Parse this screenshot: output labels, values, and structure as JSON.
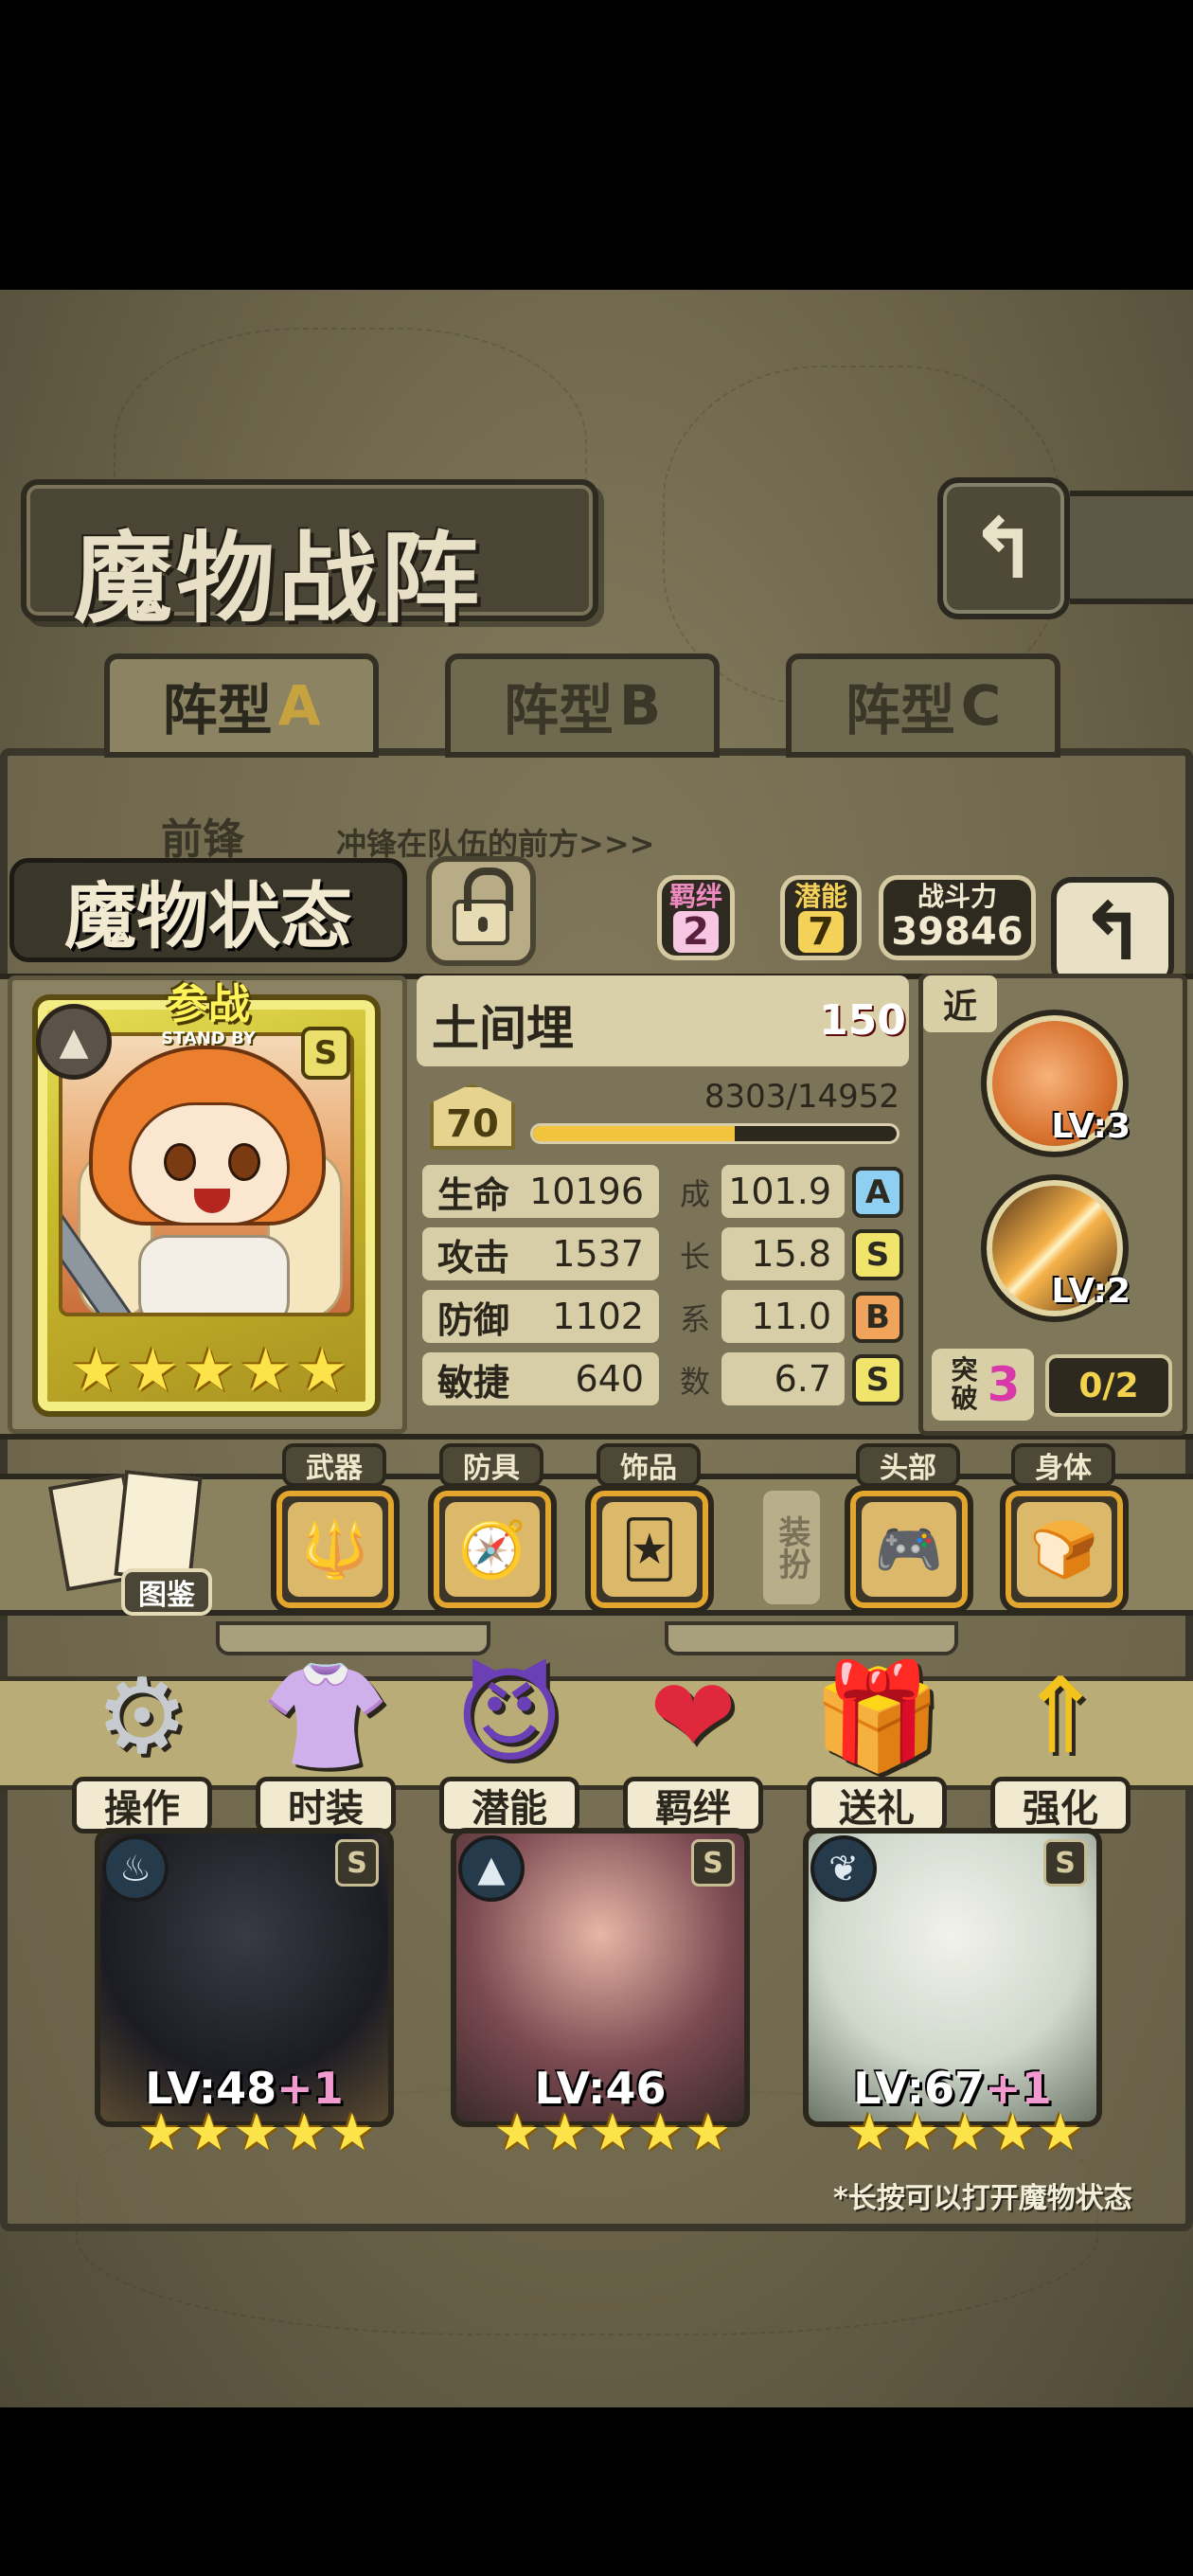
{
  "screen": {
    "title": "魔物战阵",
    "back_icon": "return-arrow-icon",
    "tabs": [
      {
        "prefix": "阵型",
        "letter": "A",
        "active": true
      },
      {
        "prefix": "阵型",
        "letter": "B",
        "active": false
      },
      {
        "prefix": "阵型",
        "letter": "C",
        "active": false
      }
    ],
    "vanguard": {
      "label": "前锋",
      "subtitle": "冲锋在队伍的前方>>>"
    },
    "hint": "*长按可以打开魔物状态"
  },
  "status_panel": {
    "title": "魔物状态",
    "lock_icon": "lock-icon",
    "bond": {
      "label": "羁绊",
      "value": "2"
    },
    "potential": {
      "label": "潜能",
      "value": "7"
    },
    "power": {
      "label": "战斗力",
      "value": "39846"
    },
    "return_icon": "return-arrow-icon"
  },
  "character": {
    "name": "土间埋",
    "level_cap": "150",
    "level": "70",
    "exp": "8303/14952",
    "exp_fraction": 0.555,
    "standby_cn": "参战",
    "standby_en": "STAND BY",
    "rank": "S",
    "element_icon": "mountain-element-icon",
    "stars": 5,
    "attributes": [
      {
        "name": "生命",
        "value": "10196",
        "growth": "101.9",
        "grade": "A",
        "growth_char": "成",
        "grade_color": "#8fd0f2"
      },
      {
        "name": "攻击",
        "value": "1537",
        "growth": "15.8",
        "grade": "S",
        "growth_char": "长",
        "grade_color": "#f0e46a"
      },
      {
        "name": "防御",
        "value": "1102",
        "growth": "11.0",
        "grade": "B",
        "growth_char": "系",
        "grade_color": "#f0a35a"
      },
      {
        "name": "敏捷",
        "value": "640",
        "growth": "6.7",
        "grade": "S",
        "growth_char": "数",
        "grade_color": "#f0e46a"
      }
    ]
  },
  "side": {
    "range": "近",
    "skills": [
      {
        "icon": "bread-bear-skill-icon",
        "level": "LV:3"
      },
      {
        "icon": "fire-slash-skill-icon",
        "level": "LV:2"
      }
    ],
    "breakthrough": {
      "label": "突破",
      "value": "3",
      "count": "0/2"
    }
  },
  "equipment": {
    "book_label": "图鉴",
    "equip_tag": "装扮",
    "slots": [
      {
        "label": "武器",
        "icon": "trident-icon",
        "glyph": "🔱"
      },
      {
        "label": "防具",
        "icon": "compass-icon",
        "glyph": "🧭"
      },
      {
        "label": "饰品",
        "icon": "card-icon",
        "glyph": "🃏"
      },
      {
        "label": "头部",
        "icon": "gamepad-icon",
        "glyph": "🎮"
      },
      {
        "label": "身体",
        "icon": "bread-icon",
        "glyph": "🍞"
      }
    ]
  },
  "actions": [
    {
      "label": "操作",
      "icon": "gear-icon",
      "glyph": "⚙",
      "color": "#c7cbd0"
    },
    {
      "label": "时装",
      "icon": "clothes-icon",
      "glyph": "👚",
      "color": "#f5a6d6"
    },
    {
      "label": "潜能",
      "icon": "demon-icon",
      "glyph": "😈",
      "color": "#6b3fb5"
    },
    {
      "label": "羁绊",
      "icon": "hearts-icon",
      "glyph": "❤",
      "color": "#e0283c"
    },
    {
      "label": "送礼",
      "icon": "gift-icon",
      "glyph": "🎁",
      "color": "#e35fc8"
    },
    {
      "label": "强化",
      "icon": "arrows-up-icon",
      "glyph": "⇑",
      "color": "#f2c21e"
    }
  ],
  "team": [
    {
      "level": "LV:48",
      "plus": "+1",
      "rank": "S",
      "element": "water-element-icon",
      "element_glyph": "♨",
      "stars": 5
    },
    {
      "level": "LV:46",
      "plus": "",
      "rank": "S",
      "element": "mountain-element-icon",
      "element_glyph": "▲",
      "stars": 5
    },
    {
      "level": "LV:67",
      "plus": "+1",
      "rank": "S",
      "element": "leaf-element-icon",
      "element_glyph": "❦",
      "stars": 5
    }
  ]
}
